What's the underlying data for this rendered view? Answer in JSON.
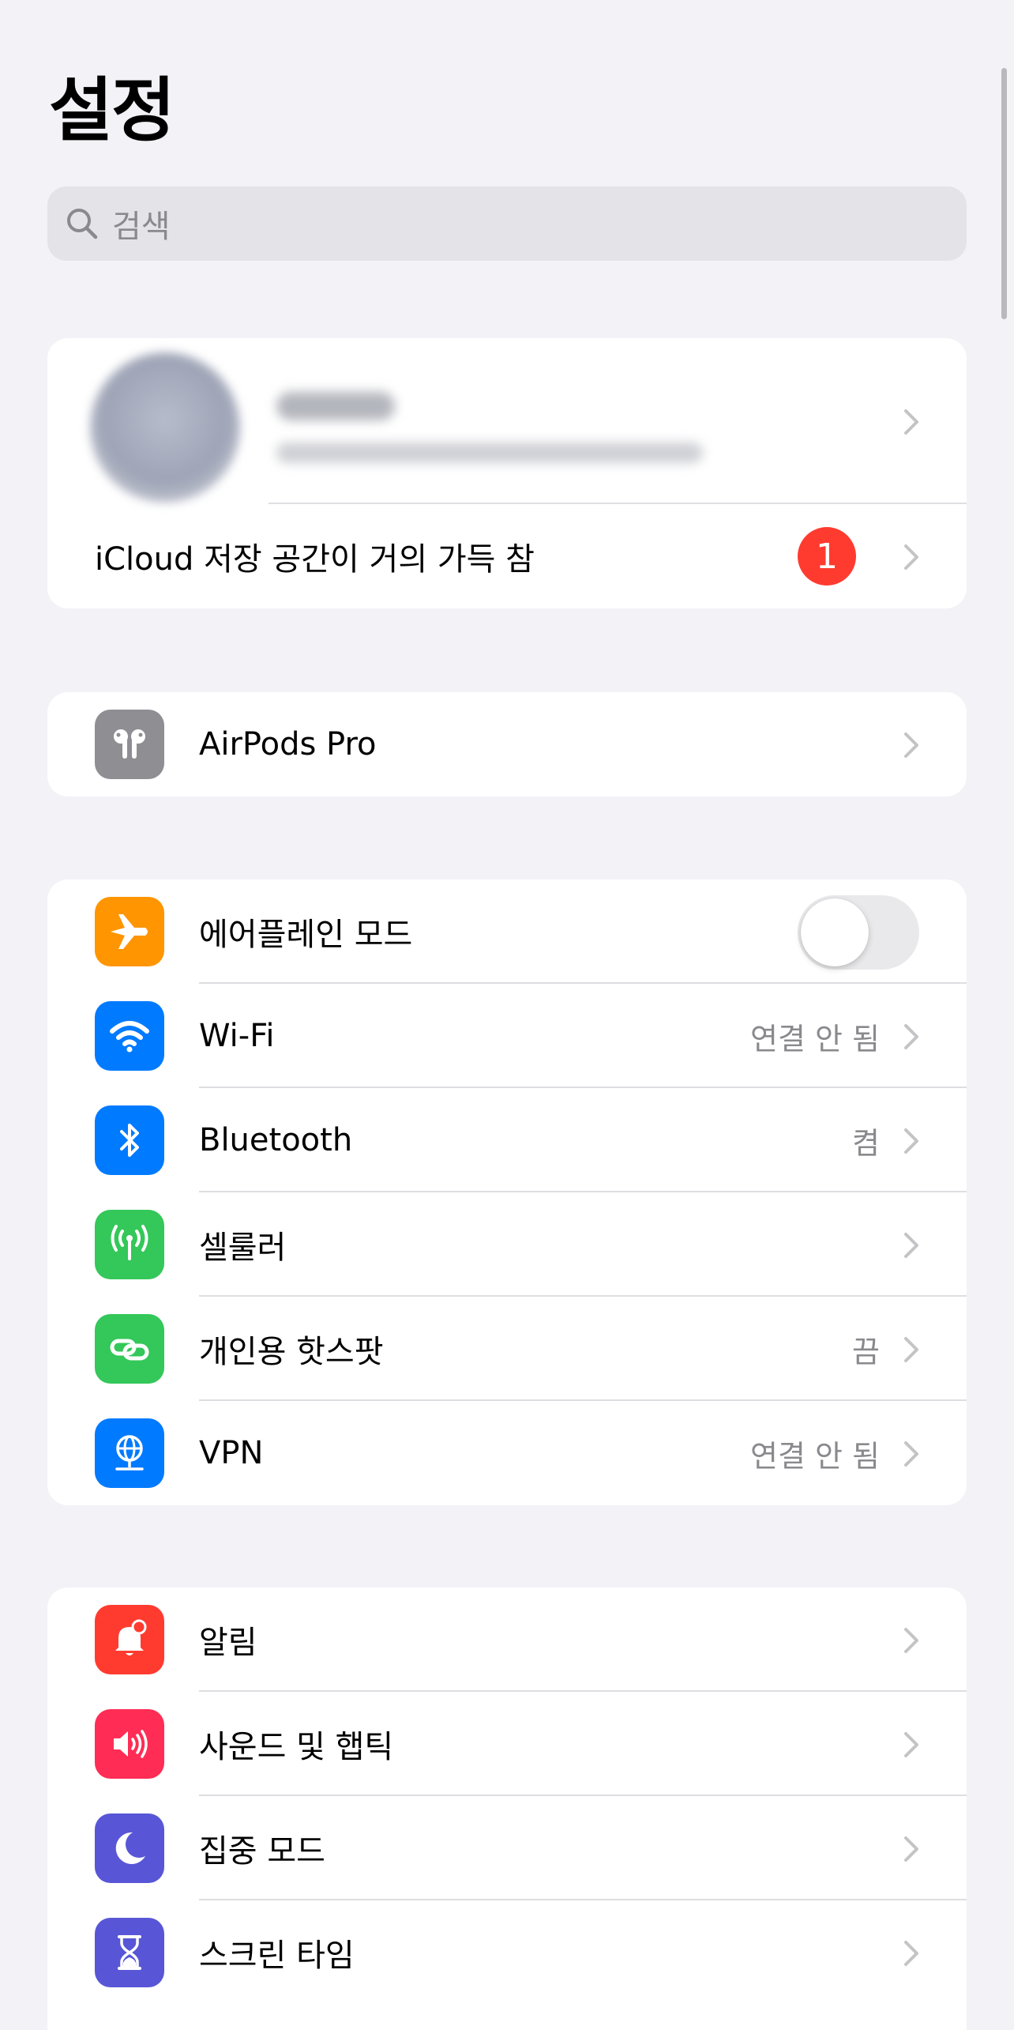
{
  "header": {
    "title": "설정"
  },
  "search": {
    "placeholder": "검색"
  },
  "account": {
    "storage_warning": "iCloud 저장 공간이 거의 가득 참",
    "badge_count": "1"
  },
  "airpods": {
    "label": "AirPods Pro",
    "icon": "airpods-icon",
    "icon_bg": "#8e8e93"
  },
  "connectivity": [
    {
      "label": "에어플레인 모드",
      "icon": "airplane-icon",
      "icon_bg": "#ff9500",
      "toggle_on": false
    },
    {
      "label": "Wi-Fi",
      "detail": "연결 안 됨",
      "icon": "wifi-icon",
      "icon_bg": "#007aff"
    },
    {
      "label": "Bluetooth",
      "detail": "켬",
      "icon": "bluetooth-icon",
      "icon_bg": "#007aff"
    },
    {
      "label": "셀룰러",
      "detail": "",
      "icon": "antenna-icon",
      "icon_bg": "#34c759"
    },
    {
      "label": "개인용 핫스팟",
      "detail": "끔",
      "icon": "hotspot-link-icon",
      "icon_bg": "#34c759"
    },
    {
      "label": "VPN",
      "detail": "연결 안 됨",
      "icon": "globe-icon",
      "icon_bg": "#007aff"
    }
  ],
  "general": [
    {
      "label": "알림",
      "icon": "bell-icon",
      "icon_bg": "#ff3b30"
    },
    {
      "label": "사운드 및 햅틱",
      "icon": "speaker-icon",
      "icon_bg": "#ff2d55"
    },
    {
      "label": "집중 모드",
      "icon": "moon-icon",
      "icon_bg": "#5856d6"
    },
    {
      "label": "스크린 타임",
      "icon": "hourglass-icon",
      "icon_bg": "#5856d6"
    }
  ]
}
